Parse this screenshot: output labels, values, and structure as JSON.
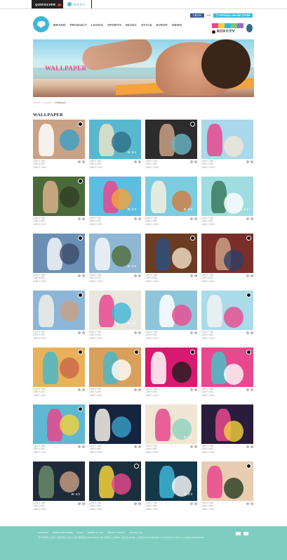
{
  "topbar": {
    "quiksilver_label": "QUIKSILVER",
    "roxy_label": "ROXY"
  },
  "header": {
    "nav": [
      "BRAND",
      "PRODUCT",
      "LOOKS",
      "SPORTS",
      "MUSIC",
      "STYLE",
      "EVENT",
      "NEWS"
    ],
    "facebook_label": "f 좋아요",
    "lang_label": "KR",
    "store_label": "ⓡ OFFICIAL ONLINE STORE",
    "roxytv_label": "ROXY/TV",
    "tv_colors": [
      "#e8488d",
      "#f4d23b",
      "#3fb6d6",
      "#7cc576",
      "#9d6bc2"
    ]
  },
  "hero": {
    "title": "WALLPAPER"
  },
  "breadcrumb": [
    "Home",
    ">",
    "Looks",
    ">",
    "Wallpaper"
  ],
  "section_title": "WALLPAPER",
  "wallpapers": [
    {
      "sizes": [
        "1024 X 768",
        "1280 X 800",
        "1280 X 1024"
      ],
      "bg": "#c9a184",
      "accent": "#ffffff",
      "accent2": "#3aa0c8",
      "badge": true,
      "mark": ""
    },
    {
      "sizes": [
        "1024 X 768",
        "1280 X 800",
        "1280 X 1024"
      ],
      "bg": "#58b8cf",
      "accent": "#e9e0c8",
      "accent2": "#2e6e86",
      "badge": false,
      "mark": "R·XY"
    },
    {
      "sizes": [
        "1024 X 768",
        "1280 X 800",
        "1280 X 1024"
      ],
      "bg": "#2c2c2c",
      "accent": "#c9a184",
      "accent2": "#6bb9c9",
      "badge": true,
      "mark": ""
    },
    {
      "sizes": [
        "1024 X 768",
        "1280 X 800",
        "1280 X 1024"
      ],
      "bg": "#a9d9ea",
      "accent": "#e8488d",
      "accent2": "#f2e6d6",
      "badge": false,
      "mark": ""
    },
    {
      "sizes": [
        "1024 X 768",
        "1280 X 800",
        "1280 X 1024"
      ],
      "bg": "#4b6a3a",
      "accent": "#d8b08d",
      "accent2": "#2f3f22",
      "badge": true,
      "mark": ""
    },
    {
      "sizes": [
        "1024 X 768",
        "1280 X 800",
        "1280 X 1024"
      ],
      "bg": "#5cbde0",
      "accent": "#e8488d",
      "accent2": "#f4a23b",
      "badge": false,
      "mark": "R·XY"
    },
    {
      "sizes": [
        "1024 X 768",
        "1280 X 800",
        "1280 X 1024"
      ],
      "bg": "#7ccde0",
      "accent": "#f6f0e0",
      "accent2": "#d27c3d",
      "badge": false,
      "mark": "R·XY"
    },
    {
      "sizes": [
        "1024 X 768",
        "1280 X 800",
        "1280 X 1024"
      ],
      "bg": "#9fdde0",
      "accent": "#3b7b5d",
      "accent2": "#ffffff",
      "badge": false,
      "mark": "R·XY"
    },
    {
      "sizes": [
        "1024 X 768",
        "1280 X 800",
        "1280 X 1024"
      ],
      "bg": "#6a8fb4",
      "accent": "#f3f6f7",
      "accent2": "#3b4a6a",
      "badge": true,
      "mark": ""
    },
    {
      "sizes": [
        "1024 X 768",
        "1280 X 800",
        "1280 X 1024"
      ],
      "bg": "#8fb7d4",
      "accent": "#f6f8f9",
      "accent2": "#4d6b3a",
      "badge": false,
      "mark": "R·XY"
    },
    {
      "sizes": [
        "1024 X 768",
        "1280 X 800",
        "1280 X 1024"
      ],
      "bg": "#6b3b22",
      "accent": "#2d4f7a",
      "accent2": "#f2e3c8",
      "badge": true,
      "mark": ""
    },
    {
      "sizes": [
        "1024 X 768",
        "1280 X 800",
        "1280 X 1024"
      ],
      "bg": "#7a2e2a",
      "accent": "#c9a184",
      "accent2": "#2f3e66",
      "badge": true,
      "mark": ""
    },
    {
      "sizes": [
        "1024 X 768",
        "1280 X 800",
        "1280 X 1024"
      ],
      "bg": "#8cb6d8",
      "accent": "#f2eee6",
      "accent2": "#c9a184",
      "badge": true,
      "mark": ""
    },
    {
      "sizes": [
        "1024 X 768",
        "1280 X 800",
        "1280 X 1024"
      ],
      "bg": "#e9e6df",
      "accent": "#e8488d",
      "accent2": "#3fb6d6",
      "badge": false,
      "mark": "R·XY"
    },
    {
      "sizes": [
        "1024 X 768",
        "1280 X 800",
        "1280 X 1024"
      ],
      "bg": "#8fc5d9",
      "accent": "#ffffff",
      "accent2": "#e8488d",
      "badge": false,
      "mark": ""
    },
    {
      "sizes": [
        "1024 X 768",
        "1280 X 800",
        "1280 X 1024"
      ],
      "bg": "#a9dbe9",
      "accent": "#f2f2f2",
      "accent2": "#e8488d",
      "badge": true,
      "mark": ""
    },
    {
      "sizes": [
        "1024 X 768",
        "1280 X 800",
        "1280 X 1024"
      ],
      "bg": "#e9b25a",
      "accent": "#4bb7c9",
      "accent2": "#c9674a",
      "badge": true,
      "mark": ""
    },
    {
      "sizes": [
        "1024 X 768",
        "1280 X 800",
        "1280 X 1024"
      ],
      "bg": "#d8a05a",
      "accent": "#4bb7c9",
      "accent2": "#ffffff",
      "badge": true,
      "mark": ""
    },
    {
      "sizes": [
        "1024 X 768",
        "1280 X 800",
        "1280 X 1024"
      ],
      "bg": "#d9186f",
      "accent": "#ffffff",
      "accent2": "#1e1e1e",
      "badge": true,
      "mark": ""
    },
    {
      "sizes": [
        "1024 X 768",
        "1280 X 800",
        "1280 X 1024"
      ],
      "bg": "#e8488d",
      "accent": "#47c3c4",
      "accent2": "#ffffff",
      "badge": true,
      "mark": ""
    },
    {
      "sizes": [
        "1024 X 768",
        "1280 X 800",
        "1280 X 1024"
      ],
      "bg": "#5fb7d2",
      "accent": "#e8488d",
      "accent2": "#f4d23b",
      "badge": true,
      "mark": ""
    },
    {
      "sizes": [
        "1024 X 768",
        "1280 X 800",
        "1280 X 1024"
      ],
      "bg": "#15243f",
      "accent": "#f5f1e6",
      "accent2": "#3aa0c8",
      "badge": false,
      "mark": ""
    },
    {
      "sizes": [
        "1024 X 768",
        "1280 X 800",
        "1280 X 1024"
      ],
      "bg": "#f1e6d3",
      "accent": "#e8488d",
      "accent2": "#8fd1c0",
      "badge": false,
      "mark": "R·XY"
    },
    {
      "sizes": [
        "1024 X 768",
        "1280 X 800",
        "1280 X 1024"
      ],
      "bg": "#2a1c3c",
      "accent": "#e8488d",
      "accent2": "#f4d23b",
      "badge": false,
      "mark": ""
    },
    {
      "sizes": [
        "1024 X 768",
        "1280 X 800",
        "1280 X 1024"
      ],
      "bg": "#1f2b3a",
      "accent": "#6b8a6b",
      "accent2": "#c9a184",
      "badge": false,
      "mark": "R·XY"
    },
    {
      "sizes": [
        "1024 X 768",
        "1280 X 800",
        "1280 X 1024"
      ],
      "bg": "#1c2f3d",
      "accent": "#f4d23b",
      "accent2": "#e8488d",
      "badge": true,
      "mark": ""
    },
    {
      "sizes": [
        "1024 X 768",
        "1280 X 800",
        "1280 X 1024"
      ],
      "bg": "#13394a",
      "accent": "#3fb6d6",
      "accent2": "#ffffff",
      "badge": false,
      "mark": "R·XY"
    },
    {
      "sizes": [
        "1024 X 768",
        "1280 X 800",
        "1280 X 1024"
      ],
      "bg": "#e9cdb2",
      "accent": "#e8488d",
      "accent2": "#263a1f",
      "badge": true,
      "mark": ""
    }
  ],
  "footer": {
    "links": [
      "COMPANY",
      "QUIKSILVER KOREA",
      "ROXY",
      "TERMS OF USE",
      "PRIVACY POLICY",
      "CONTACT US"
    ],
    "text": "(주)퀵실버록시코리아 | 서울특별시 강남구 | 사업자등록번호 000-00-00000 | 통신판매업신고 제0000-서울강남-0000호 | 고객센터 TEL 02-000-0000 | COPYRIGHT © ROXY. ALL RIGHTS RESERVED."
  }
}
